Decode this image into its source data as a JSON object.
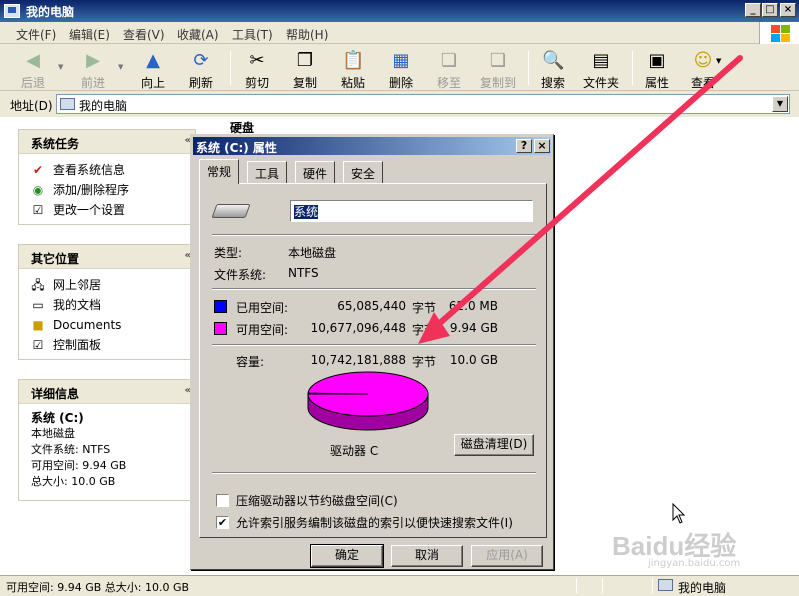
{
  "window": {
    "title": "我的电脑",
    "controls": {
      "minimize": "_",
      "maximize": "□",
      "close": "×"
    }
  },
  "menu": [
    "文件(F)",
    "编辑(E)",
    "查看(V)",
    "收藏(A)",
    "工具(T)",
    "帮助(H)"
  ],
  "toolbar": {
    "back": "后退",
    "forward": "前进",
    "up": "向上",
    "refresh": "刷新",
    "cut": "剪切",
    "copy": "复制",
    "paste": "粘贴",
    "delete": "删除",
    "move_to": "移至",
    "copy_to": "复制到",
    "search": "搜索",
    "folders": "文件夹",
    "properties": "属性",
    "views": "查看"
  },
  "address": {
    "label": "地址(D)",
    "value": "我的电脑"
  },
  "sidebar": {
    "system_tasks": {
      "title": "系统任务",
      "items": [
        "查看系统信息",
        "添加/删除程序",
        "更改一个设置"
      ]
    },
    "other_places": {
      "title": "其它位置",
      "items": [
        "网上邻居",
        "我的文档",
        "Documents",
        "控制面板"
      ]
    },
    "details": {
      "title": "详细信息",
      "name": "系统 (C:)",
      "type": "本地磁盘",
      "fs": "文件系统: NTFS",
      "free": "可用空间: 9.94 GB",
      "total": "总大小: 10.0 GB"
    }
  },
  "main": {
    "group_header": "硬盘"
  },
  "statusbar": {
    "left": "可用空间: 9.94 GB 总大小: 10.0 GB",
    "right": "我的电脑"
  },
  "dialog": {
    "title": "系统 (C:) 属性",
    "help_btn": "?",
    "close_btn": "×",
    "tabs": [
      "常规",
      "工具",
      "硬件",
      "安全"
    ],
    "volume_name": "系统",
    "type_label": "类型:",
    "type_value": "本地磁盘",
    "fs_label": "文件系统:",
    "fs_value": "NTFS",
    "used_label": "已用空间:",
    "used_bytes": "65,085,440",
    "used_unit": "字节",
    "used_size": "62.0 MB",
    "free_label": "可用空间:",
    "free_bytes": "10,677,096,448",
    "free_unit": "字节",
    "free_size": "9.94 GB",
    "cap_label": "容量:",
    "cap_bytes": "10,742,181,888",
    "cap_unit": "字节",
    "cap_size": "10.0 GB",
    "drive_label": "驱动器 C",
    "cleanup_btn": "磁盘清理(D)",
    "compress_label": "压缩驱动器以节约磁盘空间(C)",
    "index_label": "允许索引服务编制该磁盘的索引以便快速搜索文件(I)",
    "compress_checked": false,
    "index_checked": true,
    "ok": "确定",
    "cancel": "取消",
    "apply": "应用(A)",
    "used_color": "#0000FF",
    "free_color": "#FF00FF",
    "used_fraction": 0.00606
  },
  "watermark": {
    "brand": "Baidu经验",
    "url": "jingyan.baidu.com"
  }
}
